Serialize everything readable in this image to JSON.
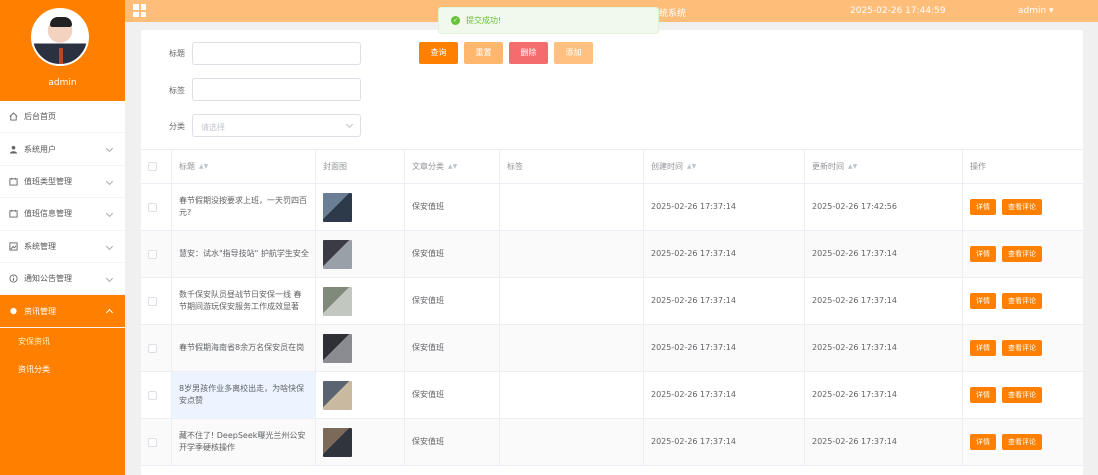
{
  "sidebar": {
    "username": "admin",
    "menu": [
      {
        "label": "后台首页",
        "icon": "home-icon"
      },
      {
        "label": "系统用户",
        "icon": "user-icon"
      },
      {
        "label": "值班类型管理",
        "icon": "calendar-icon"
      },
      {
        "label": "值班信息管理",
        "icon": "calendar-icon"
      },
      {
        "label": "系统管理",
        "icon": "image-icon"
      },
      {
        "label": "通知公告管理",
        "icon": "info-icon"
      },
      {
        "label": "资讯管理",
        "icon": "location-icon"
      }
    ],
    "submenu": [
      "安保资讯",
      "资讯分类"
    ]
  },
  "topbar": {
    "system_title": "统系统",
    "datetime": "2025-02-26 17:44:59",
    "user": "admin ▾"
  },
  "toast": {
    "message": "提交成功!"
  },
  "filters": {
    "title_label": "标题",
    "tag_label": "标签",
    "category_label": "分类",
    "category_placeholder": "请选择"
  },
  "buttons": {
    "query": "查询",
    "reset": "重置",
    "delete": "删除",
    "add": "添加"
  },
  "table": {
    "headers": [
      "标题",
      "封面图",
      "文章分类",
      "标签",
      "创建时间",
      "更新时间",
      "操作"
    ],
    "detail_label": "详情",
    "comment_label": "查看评论",
    "rows": [
      {
        "title": "春节假期没按要求上班，一天罚四百元?",
        "category": "保安值班",
        "tag": "",
        "created": "2025-02-26 17:37:14",
        "updated": "2025-02-26 17:42:56"
      },
      {
        "title": "慧安：试水\"指导技站\" 护航学生安全",
        "category": "保安值班",
        "tag": "",
        "created": "2025-02-26 17:37:14",
        "updated": "2025-02-26 17:37:14"
      },
      {
        "title": "数千保安队员昼战节日安保一线 春节期间游玩保安服务工作成效显著",
        "category": "保安值班",
        "tag": "",
        "created": "2025-02-26 17:37:14",
        "updated": "2025-02-26 17:37:14"
      },
      {
        "title": "春节假期海南省8余万名保安员在岗",
        "category": "保安值班",
        "tag": "",
        "created": "2025-02-26 17:37:14",
        "updated": "2025-02-26 17:37:14"
      },
      {
        "title": "8岁男孩作业多离校出走，为啥快保安点赞",
        "category": "保安值班",
        "tag": "",
        "created": "2025-02-26 17:37:14",
        "updated": "2025-02-26 17:37:14"
      },
      {
        "title": "藏不住了! DeepSeek曝光兰州公安开学季硬核操作",
        "category": "保安值班",
        "tag": "",
        "created": "2025-02-26 17:37:14",
        "updated": "2025-02-26 17:37:14"
      }
    ]
  },
  "colors": {
    "primary": "#ff8000",
    "topbar": "#ffbd7a",
    "reset": "#ffb66d",
    "delete": "#f56c6c",
    "add": "#ffc080"
  }
}
